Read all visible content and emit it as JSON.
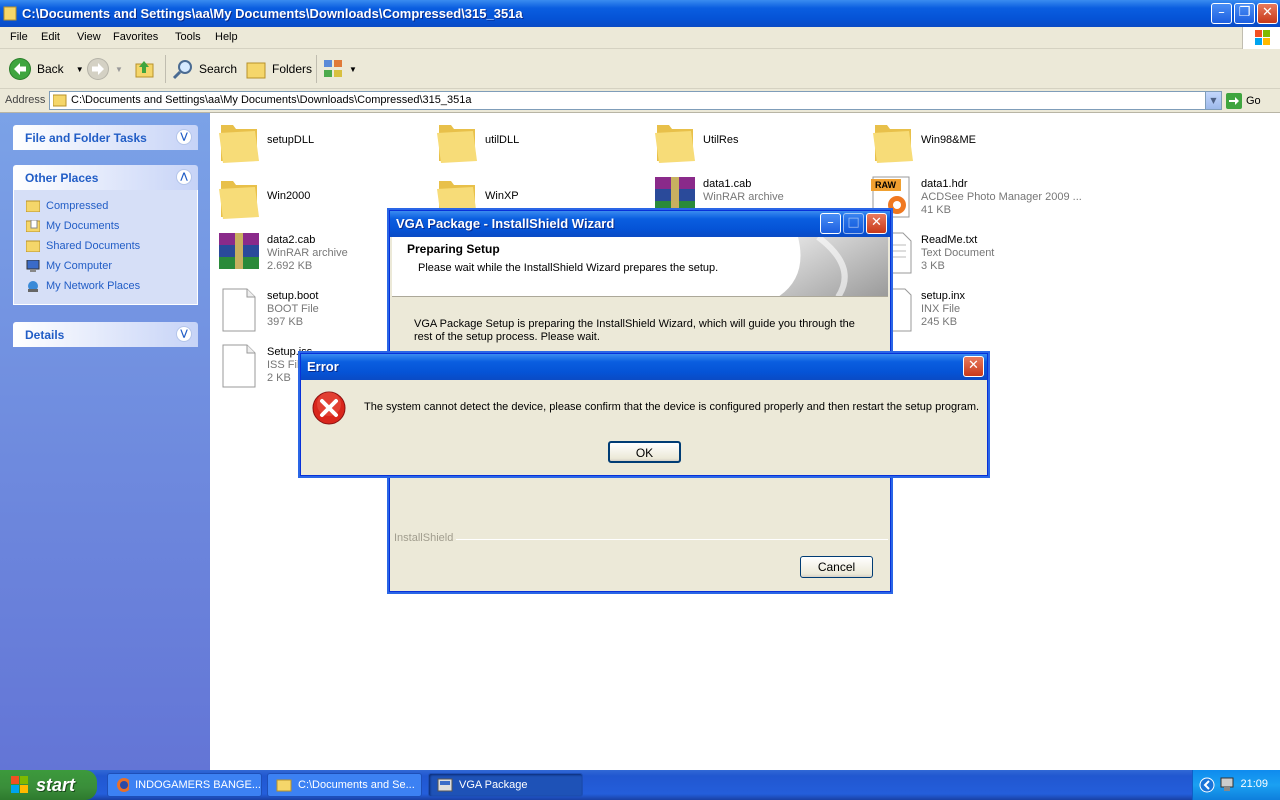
{
  "window": {
    "title": "C:\\Documents and Settings\\aa\\My Documents\\Downloads\\Compressed\\315_351a"
  },
  "menu": [
    "File",
    "Edit",
    "View",
    "Favorites",
    "Tools",
    "Help"
  ],
  "toolbar": {
    "back": "Back",
    "search": "Search",
    "folders": "Folders"
  },
  "address": {
    "label": "Address",
    "value": "C:\\Documents and Settings\\aa\\My Documents\\Downloads\\Compressed\\315_351a",
    "go": "Go"
  },
  "sidebar": {
    "file_tasks": "File and Folder Tasks",
    "other_places": {
      "title": "Other Places",
      "items": [
        "Compressed",
        "My Documents",
        "Shared Documents",
        "My Computer",
        "My Network Places"
      ]
    },
    "details": "Details"
  },
  "files": [
    {
      "name": "setupDLL",
      "type": "",
      "size": "",
      "icon": "folder-icon"
    },
    {
      "name": "utilDLL",
      "type": "",
      "size": "",
      "icon": "folder-icon"
    },
    {
      "name": "UtilRes",
      "type": "",
      "size": "",
      "icon": "folder-icon"
    },
    {
      "name": "Win98&ME",
      "type": "",
      "size": "",
      "icon": "folder-icon"
    },
    {
      "name": "Win2000",
      "type": "",
      "size": "",
      "icon": "folder-icon"
    },
    {
      "name": "WinXP",
      "type": "",
      "size": "",
      "icon": "folder-icon"
    },
    {
      "name": "data1.cab",
      "type": "WinRAR archive",
      "size": "",
      "icon": "winrar-icon"
    },
    {
      "name": "data1.hdr",
      "type": "ACDSee Photo Manager 2009 ...",
      "size": "41 KB",
      "icon": "raw-image-icon"
    },
    {
      "name": "data2.cab",
      "type": "WinRAR archive",
      "size": "2.692 KB",
      "icon": "winrar-icon"
    },
    {
      "name": "ReadMe.txt",
      "type": "Text Document",
      "size": "3 KB",
      "icon": "text-document-icon"
    },
    {
      "name": "setup.boot",
      "type": "BOOT File",
      "size": "397 KB",
      "icon": "generic-file-icon"
    },
    {
      "name": "setup.inx",
      "type": "INX File",
      "size": "245 KB",
      "icon": "generic-file-icon"
    },
    {
      "name": "Setup.iss",
      "type": "ISS File",
      "size": "2 KB",
      "icon": "generic-file-icon"
    }
  ],
  "installshield": {
    "title": "VGA Package - InstallShield Wizard",
    "step": "Preparing Setup",
    "subtitle": "Please wait while the InstallShield Wizard prepares the setup.",
    "body": "VGA Package Setup is preparing the InstallShield Wizard, which will guide you through the rest of the setup process. Please wait.",
    "brand": "InstallShield",
    "cancel": "Cancel"
  },
  "error": {
    "title": "Error",
    "message": "The system cannot detect the device, please confirm that the device is configured properly and then restart the setup program.",
    "ok": "OK"
  },
  "taskbar": {
    "start": "start",
    "tasks": [
      {
        "label": "INDOGAMERS BANGE...",
        "icon": "firefox-icon"
      },
      {
        "label": "C:\\Documents and Se...",
        "icon": "folder-icon"
      },
      {
        "label": "VGA Package",
        "icon": "installer-icon"
      }
    ],
    "clock": "21:09"
  },
  "colors": {
    "xp_blue": "#0553d6",
    "sidebar_link": "#215dc6",
    "error_red": "#d9261c"
  }
}
